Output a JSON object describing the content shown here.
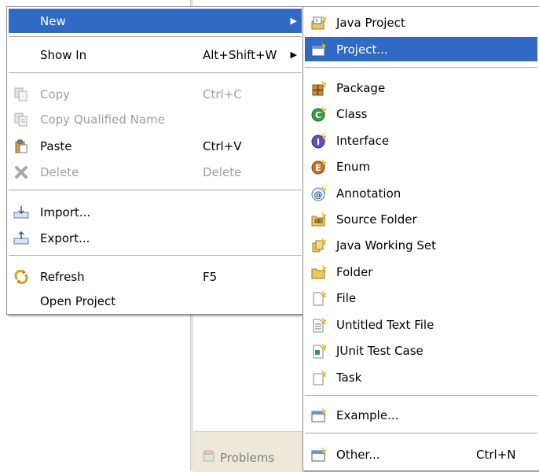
{
  "background": {
    "problems_tab": "Problems"
  },
  "context_menu": {
    "items": [
      {
        "label": "New",
        "shortcut": "",
        "has_submenu": true,
        "state": "highlighted",
        "icon": "none"
      },
      {
        "label": "Show In",
        "shortcut": "Alt+Shift+W",
        "has_submenu": true,
        "state": "normal",
        "icon": "none"
      },
      {
        "label": "Copy",
        "shortcut": "Ctrl+C",
        "has_submenu": false,
        "state": "disabled",
        "icon": "copy-icon"
      },
      {
        "label": "Copy Qualified Name",
        "shortcut": "",
        "has_submenu": false,
        "state": "disabled",
        "icon": "copy-qualified-name-icon"
      },
      {
        "label": "Paste",
        "shortcut": "Ctrl+V",
        "has_submenu": false,
        "state": "normal",
        "icon": "paste-icon"
      },
      {
        "label": "Delete",
        "shortcut": "Delete",
        "has_submenu": false,
        "state": "disabled",
        "icon": "delete-icon"
      },
      {
        "label": "Import...",
        "shortcut": "",
        "has_submenu": false,
        "state": "normal",
        "icon": "import-icon"
      },
      {
        "label": "Export...",
        "shortcut": "",
        "has_submenu": false,
        "state": "normal",
        "icon": "export-icon"
      },
      {
        "label": "Refresh",
        "shortcut": "F5",
        "has_submenu": false,
        "state": "normal",
        "icon": "refresh-icon"
      },
      {
        "label": "Open Project",
        "shortcut": "",
        "has_submenu": false,
        "state": "normal",
        "icon": "none"
      }
    ]
  },
  "new_submenu": {
    "items": [
      {
        "label": "Java Project",
        "shortcut": "",
        "state": "normal",
        "icon": "java-project-icon"
      },
      {
        "label": "Project...",
        "shortcut": "",
        "state": "highlighted",
        "icon": "project-icon"
      },
      {
        "label": "Package",
        "shortcut": "",
        "state": "normal",
        "icon": "package-icon"
      },
      {
        "label": "Class",
        "shortcut": "",
        "state": "normal",
        "icon": "class-icon"
      },
      {
        "label": "Interface",
        "shortcut": "",
        "state": "normal",
        "icon": "interface-icon"
      },
      {
        "label": "Enum",
        "shortcut": "",
        "state": "normal",
        "icon": "enum-icon"
      },
      {
        "label": "Annotation",
        "shortcut": "",
        "state": "normal",
        "icon": "annotation-icon"
      },
      {
        "label": "Source Folder",
        "shortcut": "",
        "state": "normal",
        "icon": "source-folder-icon"
      },
      {
        "label": "Java Working Set",
        "shortcut": "",
        "state": "normal",
        "icon": "java-working-set-icon"
      },
      {
        "label": "Folder",
        "shortcut": "",
        "state": "normal",
        "icon": "folder-icon"
      },
      {
        "label": "File",
        "shortcut": "",
        "state": "normal",
        "icon": "file-icon"
      },
      {
        "label": "Untitled Text File",
        "shortcut": "",
        "state": "normal",
        "icon": "untitled-text-file-icon"
      },
      {
        "label": "JUnit Test Case",
        "shortcut": "",
        "state": "normal",
        "icon": "junit-test-case-icon"
      },
      {
        "label": "Task",
        "shortcut": "",
        "state": "normal",
        "icon": "task-icon"
      },
      {
        "label": "Example...",
        "shortcut": "",
        "state": "normal",
        "icon": "example-icon"
      },
      {
        "label": "Other...",
        "shortcut": "Ctrl+N",
        "state": "normal",
        "icon": "other-icon"
      }
    ]
  },
  "colors": {
    "highlight": "#316ac5",
    "disabled_text": "#9d9d9d",
    "menu_border": "#8b8b8b"
  }
}
